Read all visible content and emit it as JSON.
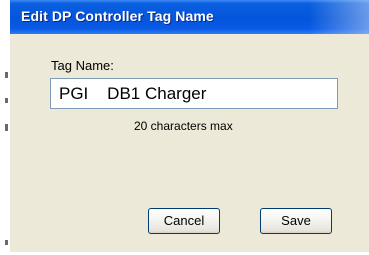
{
  "dialog": {
    "title": "Edit DP Controller Tag Name",
    "field_label": "Tag Name:",
    "tag_value": "PGI    DB1 Charger",
    "limit_note": "20 characters max",
    "cancel_label": "Cancel",
    "save_label": "Save"
  },
  "colors": {
    "titlebar": "#0455db",
    "dialog_background": "#ece9d8",
    "input_border": "#7f9db9",
    "button_border": "#003c74"
  }
}
